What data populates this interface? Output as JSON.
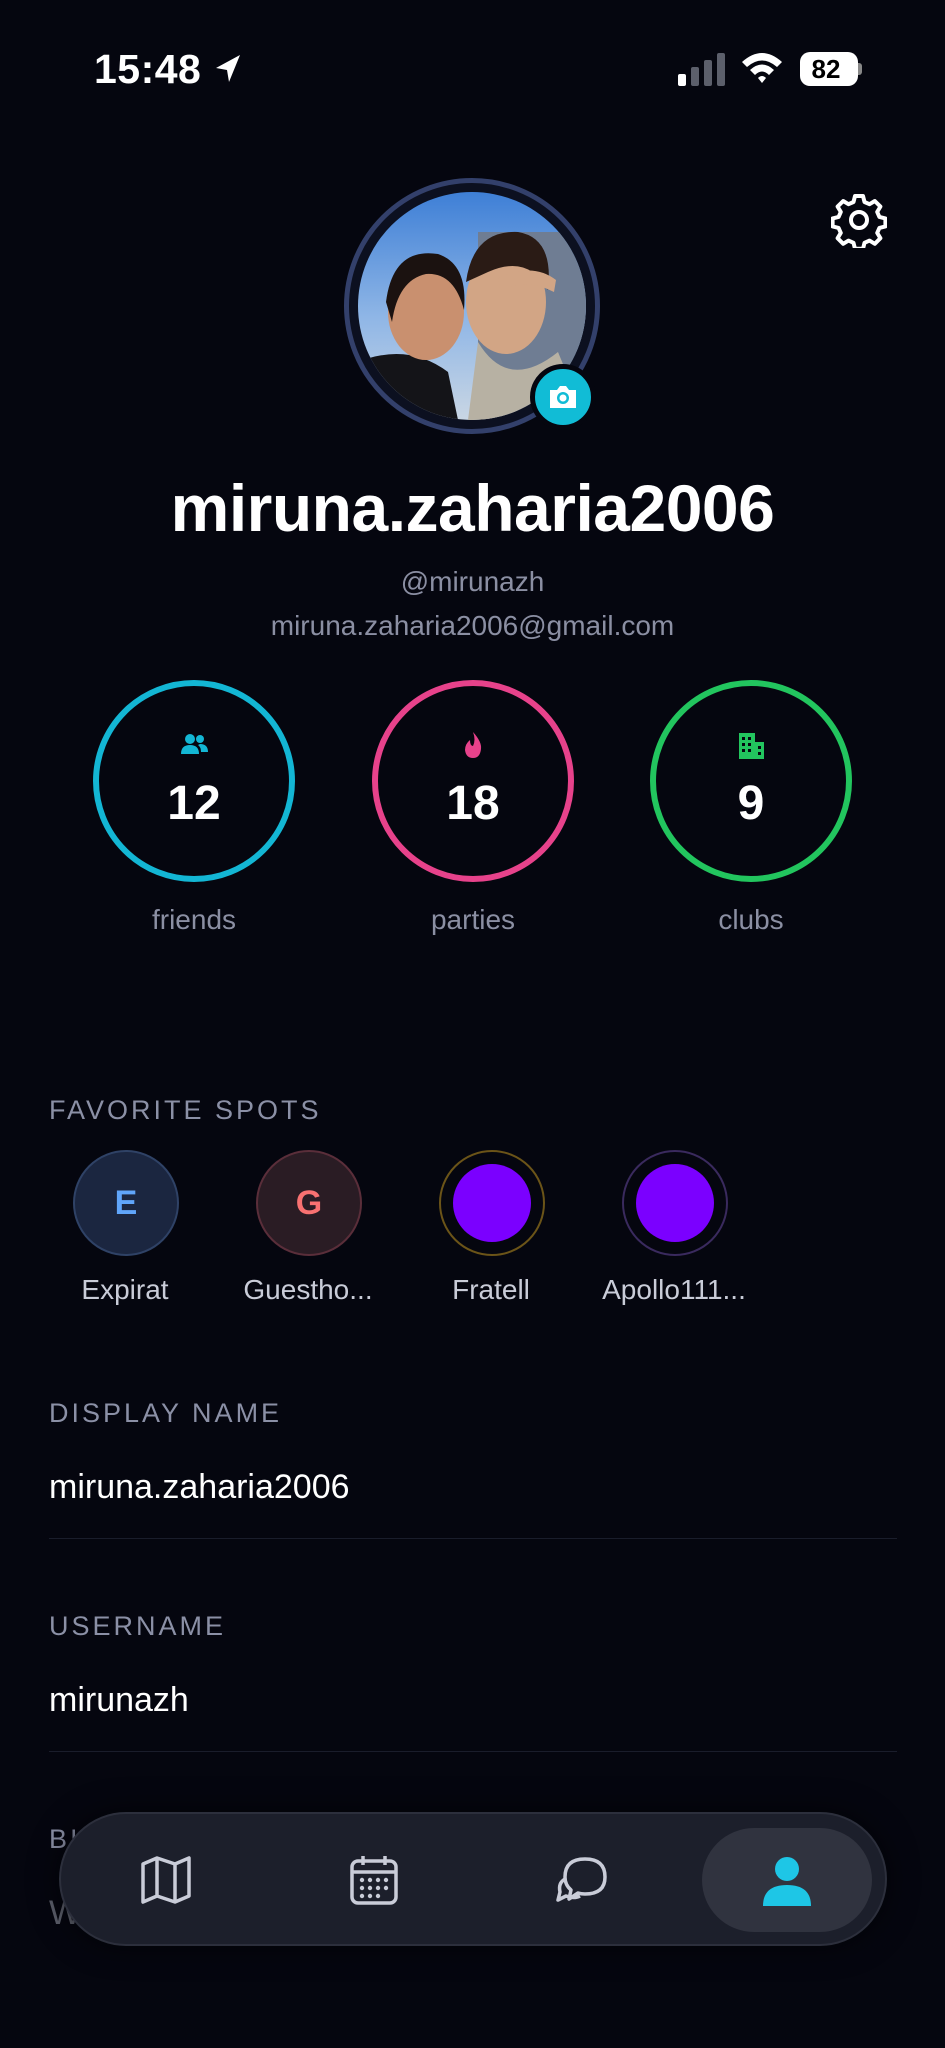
{
  "status_bar": {
    "time": "15:48",
    "battery": "82"
  },
  "profile": {
    "display_title": "miruna.zaharia2006",
    "handle": "@mirunazh",
    "email": "miruna.zaharia2006@gmail.com"
  },
  "stats": [
    {
      "value": "12",
      "label": "friends",
      "color": "#13b6d4",
      "icon": "people-icon"
    },
    {
      "value": "18",
      "label": "parties",
      "color": "#e7428b",
      "icon": "flame-icon"
    },
    {
      "value": "9",
      "label": "clubs",
      "color": "#22c55e",
      "icon": "building-icon"
    }
  ],
  "favorite_spots": {
    "title": "FAVORITE SPOTS",
    "items": [
      {
        "initial": "E",
        "label": "Expirat",
        "text_color": "#60a5fa",
        "bg": "#1b2640",
        "border": "#2f4266"
      },
      {
        "initial": "G",
        "label": "Guestho...",
        "text_color": "#f87171",
        "bg": "#2a1c24",
        "border": "#5a2e3a"
      },
      {
        "initial": "",
        "label": "Fratell",
        "fill": "#7b00ff",
        "border": "#6b5418"
      },
      {
        "initial": "",
        "label": "Apollo111...",
        "fill": "#7b00ff",
        "border": "#3a2a5e"
      }
    ]
  },
  "fields": {
    "display_name": {
      "label": "DISPLAY NAME",
      "value": "miruna.zaharia2006"
    },
    "username": {
      "label": "USERNAME",
      "value": "mirunazh"
    },
    "bio": {
      "label": "BI",
      "value": "W"
    }
  },
  "tab_bar": {
    "tabs": [
      {
        "name": "map-icon",
        "active": false
      },
      {
        "name": "calendar-icon",
        "active": false
      },
      {
        "name": "chat-icon",
        "active": false
      },
      {
        "name": "profile-icon",
        "active": true
      }
    ]
  },
  "accent_color": "#11bcd6"
}
